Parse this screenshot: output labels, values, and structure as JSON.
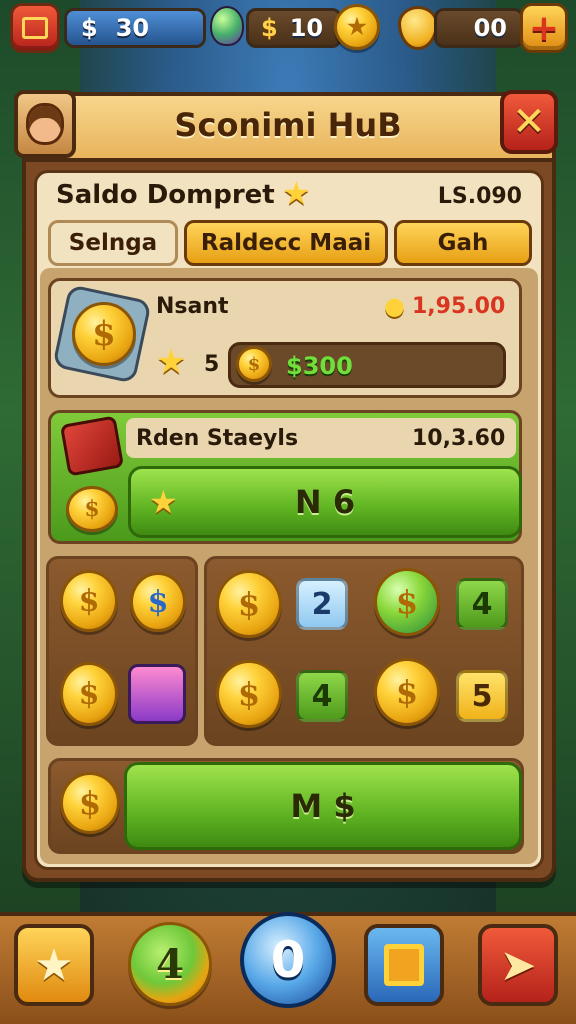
{
  "top_bar": {
    "cash": {
      "symbol": "$",
      "value": "30"
    },
    "gems": {
      "symbol": "$",
      "value": "10"
    },
    "shields": {
      "value": "00"
    },
    "add_label": "+"
  },
  "panel": {
    "title": "Sconimi HuB",
    "close_label": "✕",
    "wallet_label": "Saldo Dompret",
    "wallet_value": "LS.090",
    "tabs": [
      "Selnga",
      "Raldecc Maai",
      "Gah"
    ]
  },
  "row1": {
    "label": "Nsant",
    "price": "1,95.00",
    "star_count": "5",
    "amount": "$300"
  },
  "row2": {
    "label": "Rden Staeyls",
    "value": "10,3.60",
    "button_label": "N 6"
  },
  "grid_right": {
    "badges": [
      "2",
      "4",
      "4",
      "5"
    ]
  },
  "bottom_action": {
    "button_label": "M $"
  },
  "nav": {
    "coin_value": "4",
    "center_value": "0"
  },
  "colors": {
    "accent_gold": "#ffd23a",
    "accent_green": "#5fb322",
    "close_red": "#d8341f"
  }
}
